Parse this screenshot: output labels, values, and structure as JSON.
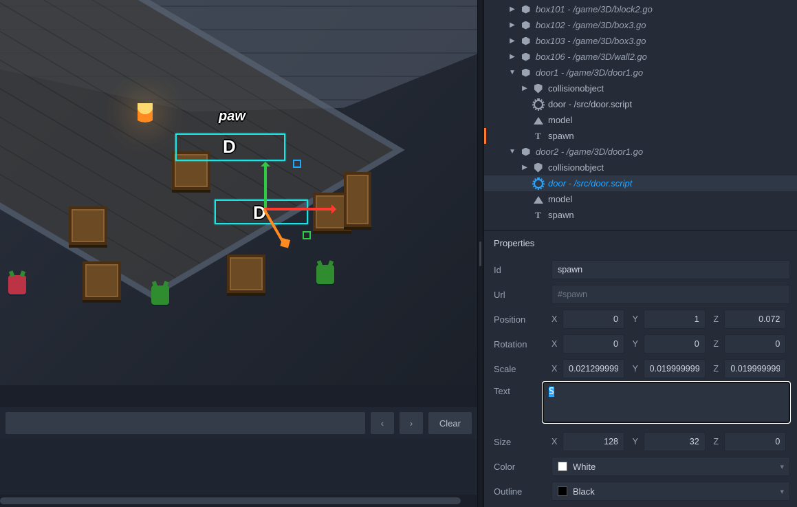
{
  "outline": {
    "nodes": [
      {
        "depth": 1,
        "arrow": "▶",
        "icon": "cube",
        "style": "go",
        "label": "box101 - /game/3D/block2.go"
      },
      {
        "depth": 1,
        "arrow": "▶",
        "icon": "cube",
        "style": "go",
        "label": "box102 - /game/3D/box3.go"
      },
      {
        "depth": 1,
        "arrow": "▶",
        "icon": "cube",
        "style": "go",
        "label": "box103 - /game/3D/box3.go"
      },
      {
        "depth": 1,
        "arrow": "▶",
        "icon": "cube",
        "style": "go",
        "label": "box106 - /game/3D/wall2.go"
      },
      {
        "depth": 1,
        "arrow": "▼",
        "icon": "cube",
        "style": "go",
        "label": "door1 - /game/3D/door1.go"
      },
      {
        "depth": 2,
        "arrow": "▶",
        "icon": "coll",
        "style": "comp",
        "label": "collisionobject"
      },
      {
        "depth": 2,
        "arrow": "",
        "icon": "gear",
        "style": "comp",
        "label": "door - /src/door.script"
      },
      {
        "depth": 2,
        "arrow": "",
        "icon": "model",
        "style": "comp",
        "label": "model"
      },
      {
        "depth": 2,
        "arrow": "",
        "icon": "text",
        "style": "comp",
        "label": "spawn",
        "marked": true
      },
      {
        "depth": 1,
        "arrow": "▼",
        "icon": "cube",
        "style": "go",
        "label": "door2 - /game/3D/door1.go"
      },
      {
        "depth": 2,
        "arrow": "▶",
        "icon": "coll",
        "style": "comp",
        "label": "collisionobject"
      },
      {
        "depth": 2,
        "arrow": "",
        "icon": "gear",
        "style": "comp",
        "label": "door - /src/door.script",
        "selected": true
      },
      {
        "depth": 2,
        "arrow": "",
        "icon": "model",
        "style": "comp",
        "label": "model"
      },
      {
        "depth": 2,
        "arrow": "",
        "icon": "text",
        "style": "comp",
        "label": "spawn"
      }
    ]
  },
  "searchbar": {
    "prev": "‹",
    "next": "›",
    "clear": "Clear",
    "value": ""
  },
  "viewport": {
    "spawn_label": "paw",
    "door_letter": "D"
  },
  "properties": {
    "title": "Properties",
    "labels": {
      "id": "Id",
      "url": "Url",
      "position": "Position",
      "rotation": "Rotation",
      "scale": "Scale",
      "text": "Text",
      "size": "Size",
      "color": "Color",
      "outline": "Outline"
    },
    "axis": {
      "x": "X",
      "y": "Y",
      "z": "Z"
    },
    "id": "spawn",
    "url": "#spawn",
    "position": {
      "x": "0",
      "y": "1",
      "z": "0.072"
    },
    "rotation": {
      "x": "0",
      "y": "0",
      "z": "0"
    },
    "scale": {
      "x": "0.02129999920",
      "y": "0.01999999955",
      "z": "0.01999999955"
    },
    "text": "S",
    "size": {
      "x": "128",
      "y": "32",
      "z": "0"
    },
    "color": {
      "name": "White",
      "hex": "#ffffff"
    },
    "outline_color": {
      "name": "Black",
      "hex": "#000000"
    }
  }
}
